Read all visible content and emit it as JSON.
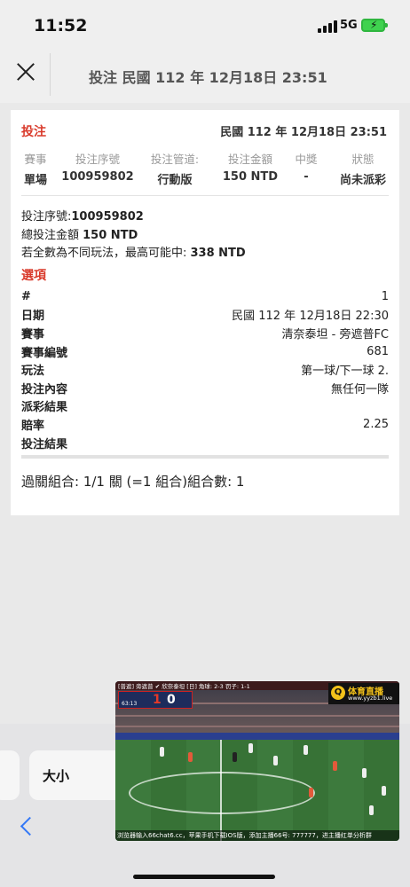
{
  "status_bar": {
    "time": "11:52",
    "network": "5G"
  },
  "header": {
    "title": "投注 民國 112 年 12月18日 23:51"
  },
  "card": {
    "heading": "投注",
    "heading_date": "民國 112 年 12月18日 23:51",
    "summary_headers": [
      "賽事",
      "投注序號",
      "投注管道:",
      "投注金額",
      "中獎",
      "狀態"
    ],
    "summary_values": [
      "單場",
      "100959802",
      "行動版",
      "150 NTD",
      "-",
      "尚未派彩"
    ],
    "info": {
      "serial_label": "投注序號:",
      "serial_value": "100959802",
      "total_label": "總投注金額 ",
      "total_value": "150 NTD",
      "max_label": "若全數為不同玩法，最高可能中: ",
      "max_value": "338 NTD"
    },
    "section_title": "選項",
    "details": [
      {
        "key": "#",
        "value": "1"
      },
      {
        "key": "日期",
        "value": "民國 112 年 12月18日 22:30"
      },
      {
        "key": "賽事",
        "value": "清奈泰坦 - 旁遮普FC"
      },
      {
        "key": "賽事編號",
        "value": "681"
      },
      {
        "key": "玩法",
        "value": "第一球/下一球 2."
      },
      {
        "key": "投注內容",
        "value": "無任何一隊"
      },
      {
        "key": "派彩結果",
        "value": ""
      },
      {
        "key": "賠率",
        "value": "2.25"
      },
      {
        "key": "投注結果",
        "value": ""
      }
    ],
    "parlay": "過關組合: 1/1 關 (=1 組合)組合數: 1"
  },
  "toolbar": {
    "size_label": "大小"
  },
  "video": {
    "ticker": "[普遮] 旁遮普 ✔ 欣奈泰坦 [日]   角球: 2-3   罚子: 1-1",
    "score_home": "1",
    "score_away": "0",
    "match_time": "63:13",
    "logo_title": "体育直播",
    "logo_url": "www.yyzb1.live",
    "caption": "浏览器输入66chat6.cc，苹果手机下载IOS版，添加主播66号: 777777，进主播红单分析群"
  },
  "colors": {
    "accent_red": "#d93a2b",
    "ios_blue": "#3478f6",
    "battery_green": "#3fd24f"
  }
}
